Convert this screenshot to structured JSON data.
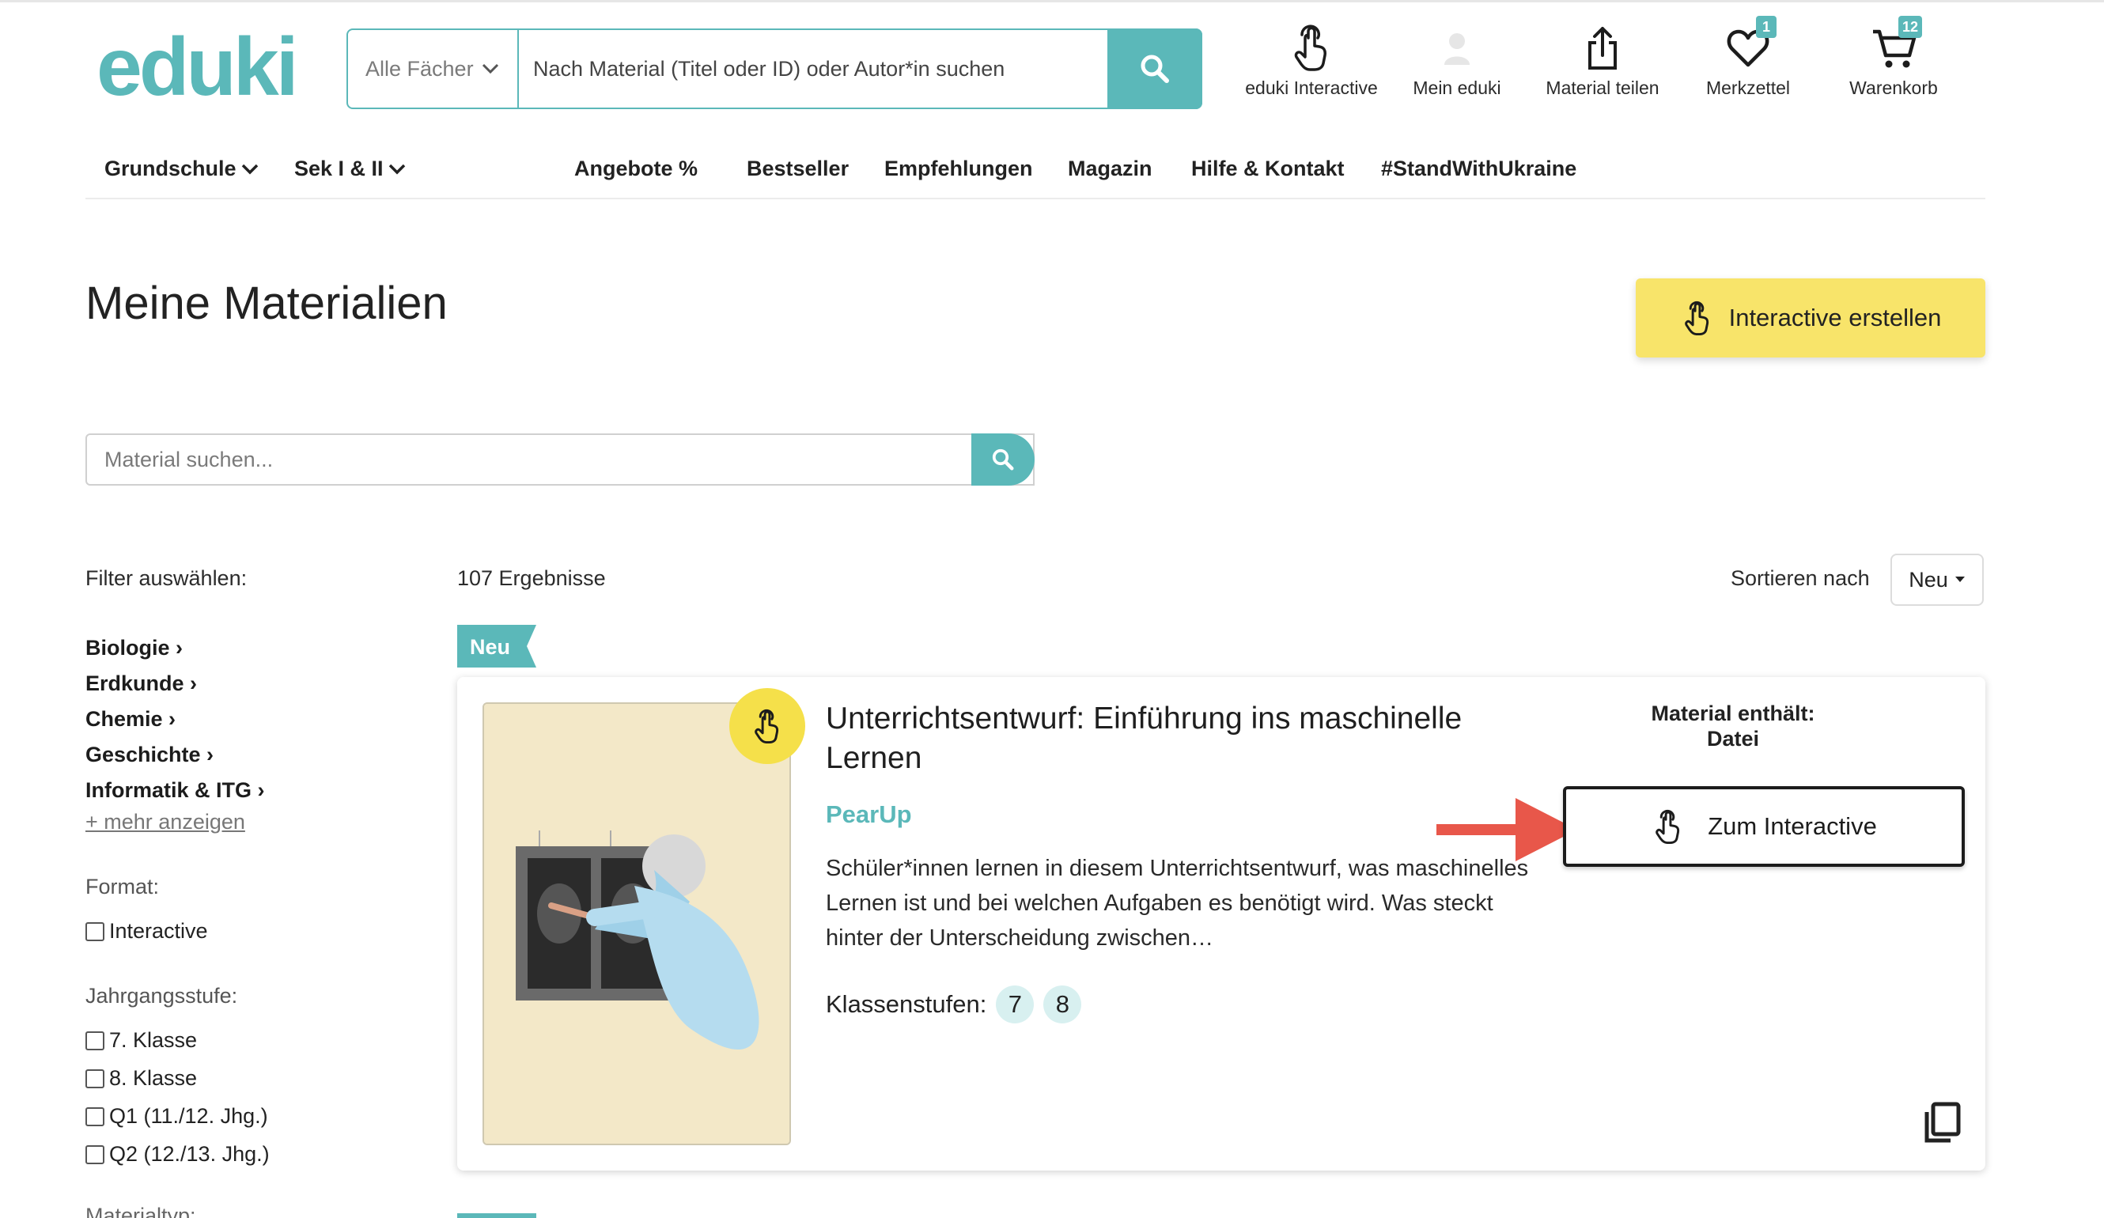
{
  "brand": {
    "logo_text": "eduki"
  },
  "header": {
    "subject_select": "Alle Fächer",
    "search_placeholder": "Nach Material (Titel oder ID) oder Autor*in suchen",
    "nav": [
      {
        "label": "eduki Interactive",
        "icon": "hand-pointer-icon"
      },
      {
        "label": "Mein eduki",
        "icon": "user-icon"
      },
      {
        "label": "Material teilen",
        "icon": "share-upload-icon"
      },
      {
        "label": "Merkzettel",
        "icon": "heart-icon",
        "badge": "1"
      },
      {
        "label": "Warenkorb",
        "icon": "cart-icon",
        "badge": "12"
      }
    ]
  },
  "menu": {
    "items": [
      "Grundschule",
      "Sek I & II",
      "Angebote %",
      "Bestseller",
      "Empfehlungen",
      "Magazin",
      "Hilfe & Kontakt",
      "#StandWithUkraine"
    ]
  },
  "page": {
    "title": "Meine Materialien",
    "create_button": "Interactive erstellen",
    "search_placeholder": "Material suchen..."
  },
  "filters": {
    "heading": "Filter auswählen:",
    "subjects": [
      "Biologie ›",
      "Erdkunde ›",
      "Chemie ›",
      "Geschichte ›",
      "Informatik & ITG ›"
    ],
    "more": "+ mehr anzeigen",
    "format_label": "Format:",
    "format_options": [
      "Interactive"
    ],
    "grade_label": "Jahrgangsstufe:",
    "grade_options": [
      "7. Klasse",
      "8. Klasse",
      "Q1 (11./12. Jhg.)",
      "Q2 (12./13. Jhg.)"
    ],
    "type_label": "Materialtyp:"
  },
  "results": {
    "count": "107 Ergebnisse",
    "sort_label": "Sortieren nach",
    "sort_value": "Neu"
  },
  "card": {
    "tag": "Neu",
    "title": "Unterrichtsentwurf: Einführung ins maschinelle Lernen",
    "author": "PearUp",
    "description": "Schüler*innen lernen in diesem Unterrichtsentwurf, was maschinelles Lernen ist und bei welchen Aufgaben es benötigt wird. Was steckt hinter der Unterscheidung zwischen…",
    "classes_label": "Klassenstufen:",
    "classes": [
      "7",
      "8"
    ],
    "contains_label": "Material enthält:",
    "contains_value": "Datei",
    "action_button": "Zum Interactive"
  },
  "colors": {
    "accent": "#5bb8b9",
    "yellow": "#f8e46a",
    "arrow": "#e8574a"
  }
}
